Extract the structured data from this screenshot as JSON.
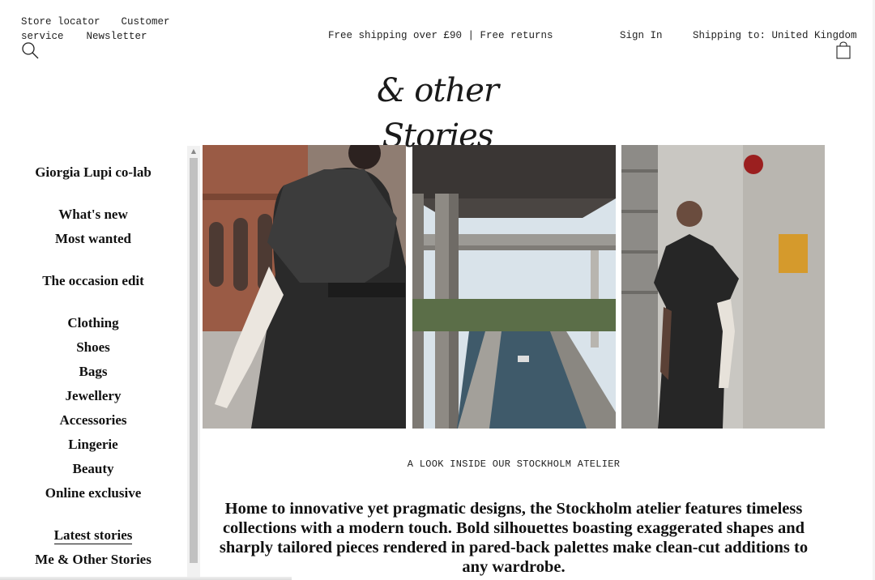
{
  "header": {
    "utility_links": [
      "Store locator",
      "Customer service",
      "Newsletter"
    ],
    "promo": "Free shipping over £90 | Free returns",
    "sign_in": "Sign In",
    "shipping_to": "Shipping to: United Kingdom",
    "logo": "& other Stories",
    "icons": [
      "search-icon",
      "shopping-bag-icon"
    ]
  },
  "sidebar": {
    "groups": [
      [
        "Giorgia Lupi co-lab"
      ],
      [
        "What's new",
        "Most wanted"
      ],
      [
        "The occasion edit"
      ],
      [
        "Clothing",
        "Shoes",
        "Bags",
        "Jewellery",
        "Accessories",
        "Lingerie",
        "Beauty",
        "Online exclusive"
      ],
      [
        "Latest stories",
        "Me & Other Stories"
      ]
    ]
  },
  "main": {
    "caption": "A LOOK INSIDE OUR STOCKHOLM ATELIER",
    "body": "Home to innovative yet pragmatic designs, the Stockholm atelier features timeless collections with a modern touch. Bold silhouettes boasting exaggerated shapes and sharply tailored pieces rendered in pared-back palettes make clean-cut additions to any wardrobe."
  }
}
